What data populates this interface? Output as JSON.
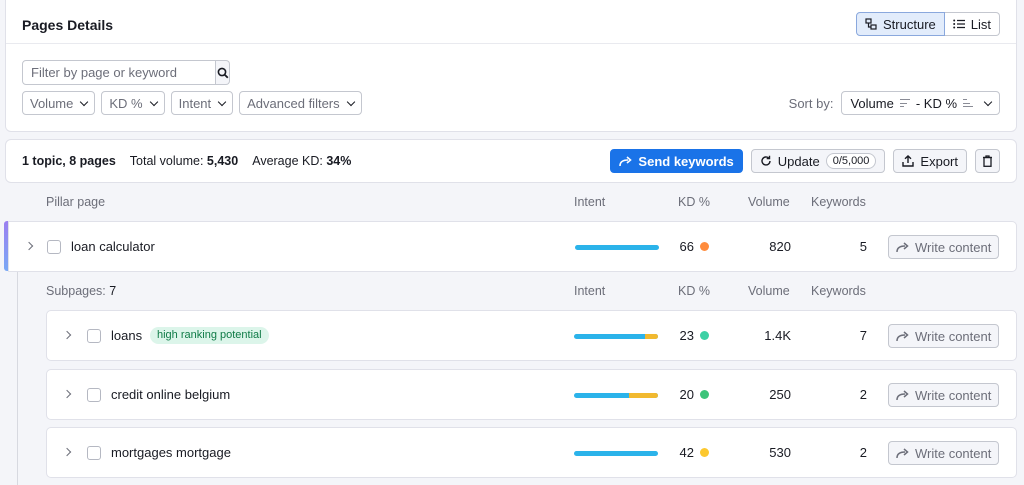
{
  "header": {
    "title": "Pages Details",
    "view_structure": "Structure",
    "view_list": "List"
  },
  "search": {
    "placeholder": "Filter by page or keyword"
  },
  "filters": [
    "Volume",
    "KD %",
    "Intent",
    "Advanced filters"
  ],
  "sort": {
    "label": "Sort by:",
    "value_volume": "Volume",
    "value_sep": "- KD %"
  },
  "summary": {
    "topics": "1 topic, 8 pages",
    "total_volume_label": "Total volume:",
    "total_volume": "5,430",
    "avg_kd_label": "Average KD:",
    "avg_kd": "34%"
  },
  "actions": {
    "send": "Send keywords",
    "update": "Update",
    "update_count": "0/5,000",
    "export": "Export"
  },
  "pillar_headers": {
    "page": "Pillar page",
    "intent": "Intent",
    "kd": "KD %",
    "volume": "Volume",
    "keywords": "Keywords"
  },
  "pillar": {
    "keyword": "loan calculator",
    "intent_mixed": 0,
    "kd": "66",
    "kd_color": "#ff8c3d",
    "volume": "820",
    "keywords": "5",
    "write": "Write content"
  },
  "sub_headers": {
    "label": "Subpages:",
    "count": "7",
    "intent": "Intent",
    "kd": "KD %",
    "volume": "Volume",
    "keywords": "Keywords"
  },
  "subpages": [
    {
      "keyword": "loans",
      "tag": "high ranking potential",
      "intent_mixed": 0.15,
      "kd": "23",
      "kd_color": "#3dd1a5",
      "volume": "1.4K",
      "keywords": "7",
      "write": "Write content"
    },
    {
      "keyword": "credit online belgium",
      "tag": "",
      "intent_mixed": 0.35,
      "kd": "20",
      "kd_color": "#3dc47a",
      "volume": "250",
      "keywords": "2",
      "write": "Write content"
    },
    {
      "keyword": "mortgages mortgage",
      "tag": "",
      "intent_mixed": 0,
      "kd": "42",
      "kd_color": "#fcc82f",
      "volume": "530",
      "keywords": "2",
      "write": "Write content"
    }
  ],
  "colors": {
    "primary": "#1a73e8",
    "intent_blue": "#2bb3ea",
    "intent_yellow": "#f1b92f",
    "tag_bg": "#dcf5ea"
  }
}
